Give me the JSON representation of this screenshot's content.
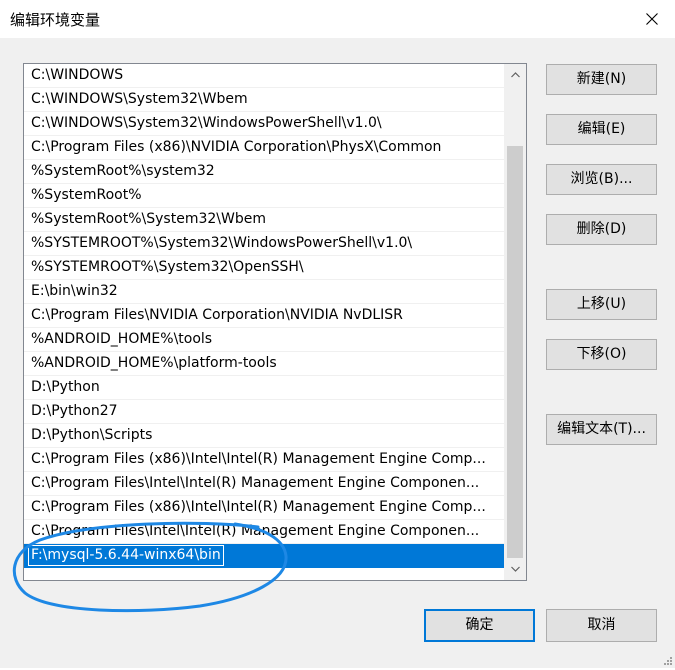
{
  "window": {
    "title": "编辑环境变量"
  },
  "path_list": {
    "items": [
      "C:\\WINDOWS",
      "C:\\WINDOWS\\System32\\Wbem",
      "C:\\WINDOWS\\System32\\WindowsPowerShell\\v1.0\\",
      "C:\\Program Files (x86)\\NVIDIA Corporation\\PhysX\\Common",
      "%SystemRoot%\\system32",
      "%SystemRoot%",
      "%SystemRoot%\\System32\\Wbem",
      "%SYSTEMROOT%\\System32\\WindowsPowerShell\\v1.0\\",
      "%SYSTEMROOT%\\System32\\OpenSSH\\",
      "E:\\bin\\win32",
      "C:\\Program Files\\NVIDIA Corporation\\NVIDIA NvDLISR",
      "%ANDROID_HOME%\\tools",
      "%ANDROID_HOME%\\platform-tools",
      "D:\\Python",
      "D:\\Python27",
      "D:\\Python\\Scripts",
      "C:\\Program Files (x86)\\Intel\\Intel(R) Management Engine Comp...",
      "C:\\Program Files\\Intel\\Intel(R) Management Engine Componen...",
      "C:\\Program Files (x86)\\Intel\\Intel(R) Management Engine Comp...",
      "C:\\Program Files\\Intel\\Intel(R) Management Engine Componen..."
    ],
    "editing_value": "F:\\mysql-5.6.44-winx64\\bin"
  },
  "buttons": {
    "new": "新建(N)",
    "edit": "编辑(E)",
    "browse": "浏览(B)...",
    "delete": "删除(D)",
    "move_up": "上移(U)",
    "move_down": "下移(O)",
    "edit_text": "编辑文本(T)...",
    "ok": "确定",
    "cancel": "取消"
  },
  "colors": {
    "selection": "#0078d7",
    "annotation": "#1e88e5"
  },
  "icons": {
    "close": "close-icon",
    "scroll_up": "chevron-up-icon",
    "scroll_down": "chevron-down-icon"
  }
}
